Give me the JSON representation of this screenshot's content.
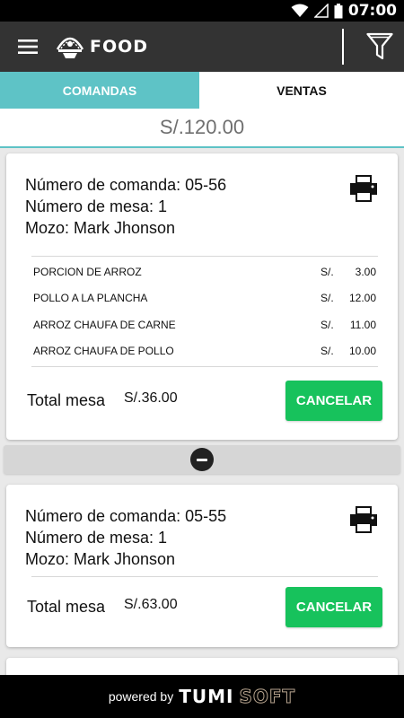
{
  "status_bar": {
    "time": "07:00",
    "icons": [
      "wifi-icon",
      "signal-icon",
      "battery-icon"
    ]
  },
  "app_bar": {
    "logo_text": "FOOD",
    "menu_icon": "hamburger-icon",
    "filter_icon": "funnel-icon"
  },
  "tabs": [
    {
      "label": "COMANDAS",
      "active": true
    },
    {
      "label": "VENTAS",
      "active": false
    }
  ],
  "total": "S/.120.00",
  "orders": [
    {
      "comanda": "Número de comanda: 05-56",
      "mesa": "Número de mesa: 1",
      "mozo": "Mozo: Mark Jhonson",
      "items": [
        {
          "name": "PORCION DE ARROZ",
          "currency": "S/.",
          "price": "3.00"
        },
        {
          "name": "POLLO A LA PLANCHA",
          "currency": "S/.",
          "price": "12.00"
        },
        {
          "name": "ARROZ CHAUFA DE CARNE",
          "currency": "S/.",
          "price": "11.00"
        },
        {
          "name": "ARROZ CHAUFA DE POLLO",
          "currency": "S/.",
          "price": "10.00"
        }
      ],
      "total_label": "Total mesa",
      "total_value": "S/.36.00",
      "cancel_label": "CANCELAR"
    },
    {
      "comanda": "Número de comanda: 05-55",
      "mesa": "Número de mesa: 1",
      "mozo": "Mozo: Mark Jhonson",
      "items": [],
      "total_label": "Total mesa",
      "total_value": "S/.63.00",
      "cancel_label": "CANCELAR"
    }
  ],
  "footer": {
    "powered": "powered by",
    "brand_a": "TUMI",
    "brand_b": "SOFT"
  },
  "colors": {
    "accent": "#5ec3c6",
    "appbar": "#333333",
    "cancel": "#17c25c"
  }
}
